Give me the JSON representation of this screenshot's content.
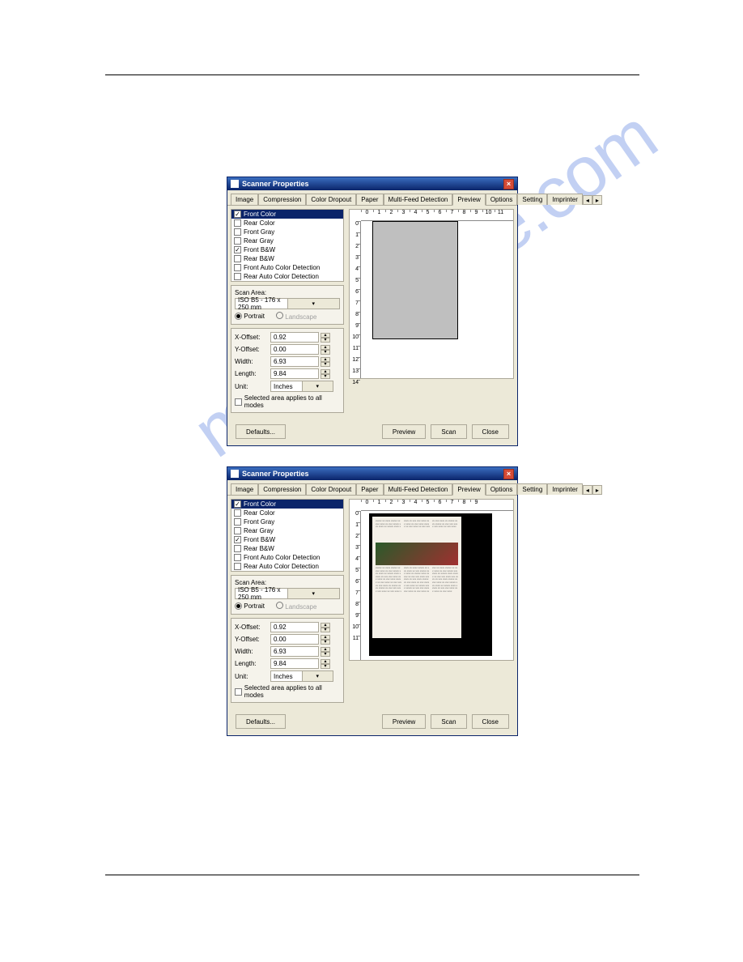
{
  "watermark_text": "manualshive.com",
  "dialogs": {
    "title": "Scanner Properties",
    "tabs": [
      "Image",
      "Compression",
      "Color Dropout",
      "Paper",
      "Multi-Feed Detection",
      "Preview",
      "Options",
      "Setting",
      "Imprinter"
    ],
    "active_tab": "Preview",
    "checkboxes": [
      {
        "label": "Front Color",
        "checked": true,
        "selected": true
      },
      {
        "label": "Rear Color",
        "checked": false
      },
      {
        "label": "Front Gray",
        "checked": false
      },
      {
        "label": "Rear Gray",
        "checked": false
      },
      {
        "label": "Front B&W",
        "checked": true
      },
      {
        "label": "Rear B&W",
        "checked": false
      },
      {
        "label": "Front Auto Color Detection",
        "checked": false
      },
      {
        "label": "Rear Auto Color Detection",
        "checked": false
      }
    ],
    "scan_area_label": "Scan Area:",
    "scan_area_value": "ISO B5 - 176 x 250 mm",
    "orientation": {
      "portrait_label": "Portrait",
      "landscape_label": "Landscape",
      "portrait_on": true
    },
    "fields": {
      "xoffset": {
        "label": "X-Offset:",
        "value": "0.92"
      },
      "yoffset": {
        "label": "Y-Offset:",
        "value": "0.00"
      },
      "width": {
        "label": "Width:",
        "value": "6.93"
      },
      "length": {
        "label": "Length:",
        "value": "9.84"
      },
      "unit": {
        "label": "Unit:",
        "value": "Inches"
      }
    },
    "selected_applies_label": "Selected area applies to all modes",
    "defaults_btn": "Defaults...",
    "preview_btn": "Preview",
    "scan_btn": "Scan",
    "close_btn": "Close"
  },
  "ruler_h": [
    "0",
    "1",
    "2",
    "3",
    "4",
    "5",
    "6",
    "7",
    "8",
    "9",
    "10",
    "11"
  ],
  "ruler_h2": [
    "0",
    "1",
    "2",
    "3",
    "4",
    "5",
    "6",
    "7",
    "8",
    "9"
  ],
  "ruler_v": [
    "0",
    "1",
    "2",
    "3",
    "4",
    "5",
    "6",
    "7",
    "8",
    "9",
    "10",
    "11",
    "12",
    "13",
    "14"
  ],
  "ruler_v2": [
    "0",
    "1",
    "2",
    "3",
    "4",
    "5",
    "6",
    "7",
    "8",
    "9",
    "10",
    "11"
  ]
}
